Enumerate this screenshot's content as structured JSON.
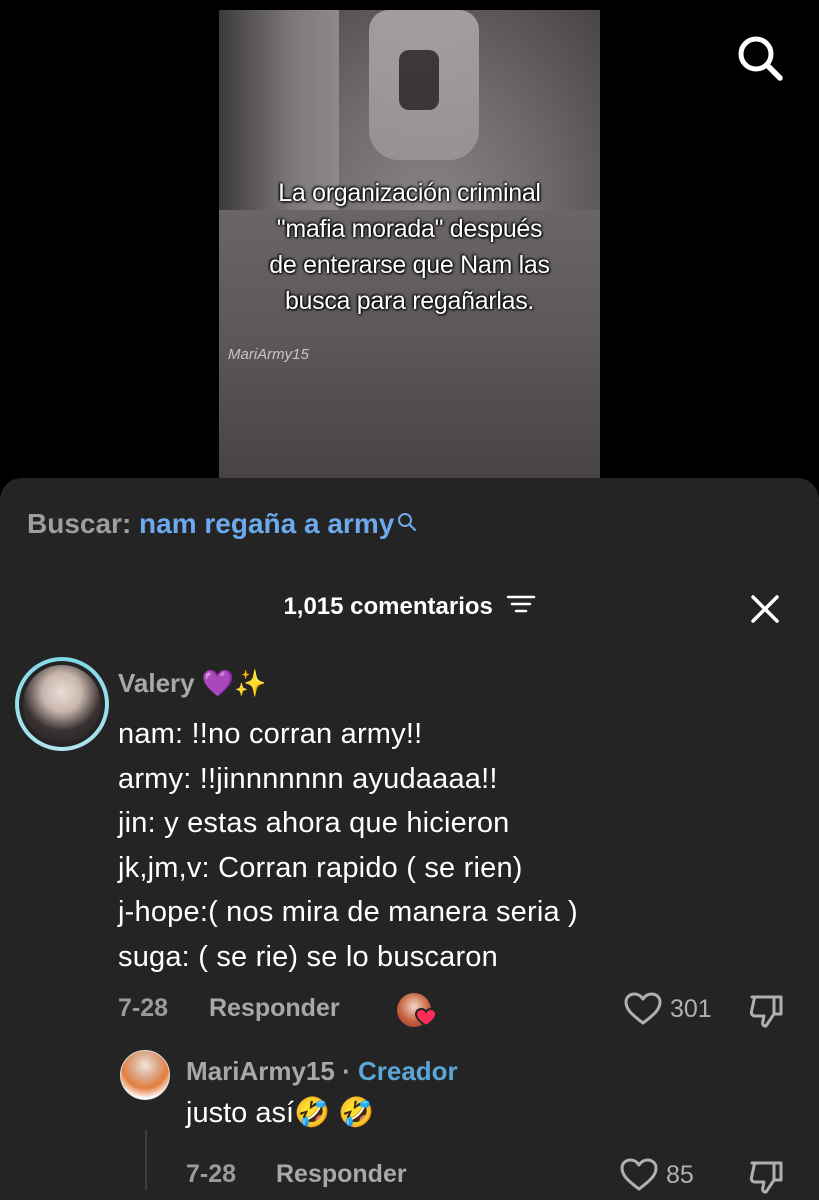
{
  "video": {
    "caption": "La organización criminal\n\"mafia morada\" después\nde enterarse que Nam las\nbusca para regañarlas.",
    "watermark": "MariArmy15"
  },
  "top_bar": {
    "search_icon": "search-icon"
  },
  "sheet": {
    "search_label": "Buscar:",
    "search_query": "nam regaña a army",
    "comments_count": "1,015 comentarios",
    "filter_icon": "filter-icon",
    "close_icon": "close-icon"
  },
  "comment": {
    "author": "Valery 💜✨",
    "text": "nam: !!no corran army!!\narmy: !!jinnnnnnn ayudaaaa!!\njin: y estas ahora que hicieron\njk,jm,v: Corran rapido ( se rien)\nj-hope:( nos mira de manera seria )\nsuga: ( se rie) se lo buscaron",
    "date": "7-28",
    "reply_label": "Responder",
    "likes": "301"
  },
  "reply": {
    "author": "MariArmy15",
    "separator": " · ",
    "badge": "Creador",
    "text": "justo así🤣 🤣",
    "date": "7-28",
    "reply_label": "Responder",
    "likes": "85"
  },
  "colors": {
    "sheet_bg": "#242424",
    "query_blue": "#6ea9ee",
    "creator_blue": "#5aa6d6",
    "muted_text": "#9b9b9b"
  }
}
